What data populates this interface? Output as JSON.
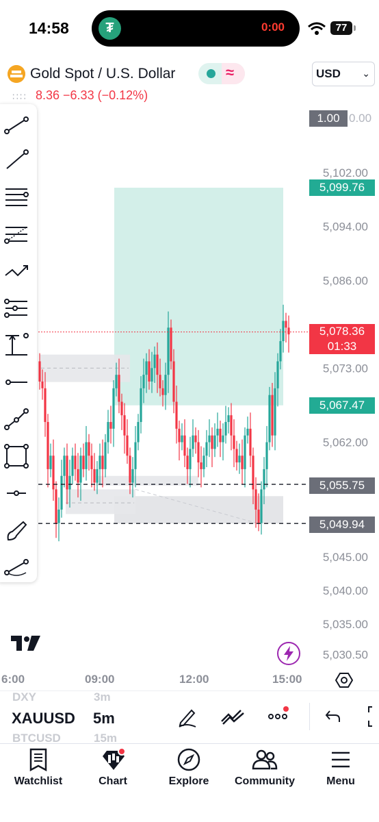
{
  "status_bar": {
    "time": "14:58",
    "timer": "0:00",
    "battery": "77"
  },
  "header": {
    "symbol_title": "Gold Spot / U.S. Dollar",
    "currency": "USD",
    "price_change": "8.36  −6.33 (−0.12%)"
  },
  "toolbar": {
    "tools": [
      "trend-line-tool",
      "ray-tool",
      "horizontal-lines-tool",
      "fib-retracement-tool",
      "path-tool",
      "fib-extension-tool",
      "long-position-tool",
      "horizontal-ray-tool",
      "polyline-tool",
      "rectangle-tool",
      "price-label-tool",
      "brush-tool",
      "cyclic-lines-tool"
    ]
  },
  "price_axis": {
    "labels": [
      "5,102.00",
      "5,094.00",
      "5,086.00",
      "5,073.00",
      "5,062.00",
      "5,045.00",
      "5,040.00",
      "5,035.00",
      "5,030.50"
    ],
    "top_tag": "1.00",
    "top_partial": "0.00",
    "target_tag": "5,099.76",
    "current_price": "5,078.36",
    "countdown": "01:33",
    "stop_tag": "5,067.47",
    "line1_tag": "5,055.75",
    "line2_tag": "5,049.94"
  },
  "colors": {
    "up": "#26a69a",
    "down": "#f23645",
    "target_zone": "#d3efe9",
    "stop_zone": "#e4e5e8",
    "gray_tag": "#6b6e78",
    "green_tag": "#22ab94",
    "red_tag": "#f23645"
  },
  "time_axis": [
    "6:00",
    "09:00",
    "12:00",
    "15:00"
  ],
  "symbol_bar": {
    "prev_symbol": "DXY",
    "prev_interval": "3m",
    "symbol": "XAUUSD",
    "interval": "5m",
    "next_symbol": "BTCUSD",
    "next_interval": "15m"
  },
  "nav": [
    "Watchlist",
    "Chart",
    "Explore",
    "Community",
    "Menu"
  ],
  "chart_data": {
    "type": "candlestick",
    "title": "Gold Spot / U.S. Dollar",
    "interval": "5m",
    "x_ticks": [
      "6:00",
      "09:00",
      "12:00",
      "15:00"
    ],
    "y_ticks": [
      5102.0,
      5094.0,
      5086.0,
      5073.0,
      5062.0,
      5045.0,
      5040.0,
      5035.0,
      5030.5
    ],
    "ylim": [
      5030,
      5110
    ],
    "last_price": 5078.36,
    "target": 5099.76,
    "stop": 5067.47,
    "horizontal_lines": [
      5055.75,
      5049.94
    ],
    "close_series": [
      5071,
      5070,
      5065,
      5058,
      5060,
      5055,
      5050,
      5052,
      5057,
      5060,
      5055,
      5057,
      5060,
      5058,
      5056,
      5060,
      5058,
      5062,
      5060,
      5058,
      5056,
      5058,
      5060,
      5058,
      5062,
      5065,
      5064,
      5070,
      5072,
      5068,
      5066,
      5063,
      5060,
      5056,
      5058,
      5062,
      5065,
      5070,
      5072,
      5074,
      5071,
      5073,
      5075,
      5072,
      5070,
      5069,
      5072,
      5079,
      5074,
      5068,
      5064,
      5062,
      5063,
      5060,
      5058,
      5061,
      5063,
      5062,
      5059,
      5058,
      5060,
      5062,
      5063,
      5061,
      5063,
      5064,
      5062,
      5063,
      5065,
      5066,
      5063,
      5061,
      5059,
      5060,
      5058,
      5063,
      5064,
      5060,
      5055,
      5052,
      5050,
      5055,
      5058,
      5062,
      5069,
      5063,
      5070,
      5074,
      5077,
      5080,
      5079,
      5078
    ]
  }
}
